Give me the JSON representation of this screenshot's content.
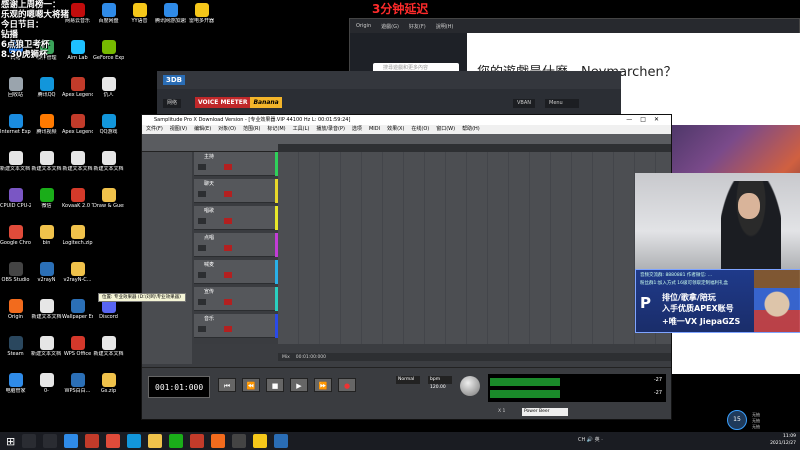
{
  "stream_overlay": {
    "lines": [
      "感谢上周榜一：",
      "乐观的嗯嗯大将猪",
      "今日节目：",
      "钻播",
      "6点狼卫考杯",
      "8.30虎狮杯"
    ],
    "delay_notice": "3分钟延迟"
  },
  "desktop_icons": [
    {
      "label": "网络",
      "color": "#2d7be0",
      "col": 0,
      "row": 1
    },
    {
      "label": "回收站",
      "color": "#9aa4ad",
      "col": 0,
      "row": 2
    },
    {
      "label": "Internet Explorer",
      "color": "#1a8ce0",
      "col": 0,
      "row": 3
    },
    {
      "label": "新建文本文档 (2)",
      "color": "#e6e6e6",
      "col": 0,
      "row": 4
    },
    {
      "label": "CPUID CPU-Z",
      "color": "#7a56c4",
      "col": 0,
      "row": 5
    },
    {
      "label": "Google Chrome",
      "color": "#e04b3a",
      "col": 0,
      "row": 6
    },
    {
      "label": "OBS Studio",
      "color": "#444444",
      "col": 0,
      "row": 7
    },
    {
      "label": "Origin",
      "color": "#f26b1d",
      "col": 0,
      "row": 8
    },
    {
      "label": "Steam",
      "color": "#2a475e",
      "col": 0,
      "row": 9
    },
    {
      "label": "电脑管家",
      "color": "#2f8be8",
      "col": 0,
      "row": 10
    },
    {
      "label": "软件管理",
      "color": "#3aa35a",
      "col": 1,
      "row": 1
    },
    {
      "label": "腾讯QQ",
      "color": "#1296db",
      "col": 1,
      "row": 2
    },
    {
      "label": "腾讯视频",
      "color": "#ff7a00",
      "col": 1,
      "row": 3
    },
    {
      "label": "新建文本文档",
      "color": "#e6e6e6",
      "col": 1,
      "row": 4
    },
    {
      "label": "微信",
      "color": "#1aad19",
      "col": 1,
      "row": 5
    },
    {
      "label": "bin",
      "color": "#f0c24b",
      "col": 1,
      "row": 6
    },
    {
      "label": "v2rayN",
      "color": "#2b6fb6",
      "col": 1,
      "row": 7
    },
    {
      "label": "新建文本文档",
      "color": "#e6e6e6",
      "col": 1,
      "row": 8
    },
    {
      "label": "新建文本文档 (2)",
      "color": "#e6e6e6",
      "col": 1,
      "row": 9
    },
    {
      "label": "0-",
      "color": "#e6e6e6",
      "col": 1,
      "row": 10
    },
    {
      "label": "网易云音乐",
      "color": "#c20c0c",
      "col": 2,
      "row": 0
    },
    {
      "label": "Aim Lab",
      "color": "#1ec0ff",
      "col": 2,
      "row": 1
    },
    {
      "label": "Apex Legends",
      "color": "#c23b2a",
      "col": 2,
      "row": 2
    },
    {
      "label": "Apex Legends",
      "color": "#c23b2a",
      "col": 2,
      "row": 3
    },
    {
      "label": "新建文本文档",
      "color": "#e6e6e6",
      "col": 2,
      "row": 4
    },
    {
      "label": "KovaaK 2.0 The Meta",
      "color": "#d43a2a",
      "col": 2,
      "row": 5
    },
    {
      "label": "Logitech.zip",
      "color": "#f0c24b",
      "col": 2,
      "row": 6
    },
    {
      "label": "v2rayN-C...",
      "color": "#f0c24b",
      "col": 2,
      "row": 7
    },
    {
      "label": "Wallpaper Engine: ...",
      "color": "#2b6fb6",
      "col": 2,
      "row": 8
    },
    {
      "label": "WPS Office",
      "color": "#d4382b",
      "col": 2,
      "row": 9
    },
    {
      "label": "WPS白白...",
      "color": "#2b6fb6",
      "col": 2,
      "row": 10
    },
    {
      "label": "百度网盘",
      "color": "#2f8be8",
      "col": 3,
      "row": 0
    },
    {
      "label": "GeForce Experience",
      "color": "#76b900",
      "col": 3,
      "row": 1
    },
    {
      "label": "仇人",
      "color": "#e6e6e6",
      "col": 3,
      "row": 2
    },
    {
      "label": "QQ游戏",
      "color": "#1296db",
      "col": 3,
      "row": 3
    },
    {
      "label": "新建文本文档",
      "color": "#e6e6e6",
      "col": 3,
      "row": 4
    },
    {
      "label": "Draw & Guess",
      "color": "#f0c24b",
      "col": 3,
      "row": 5
    },
    {
      "label": "Discord",
      "color": "#5865f2",
      "col": 3,
      "row": 8
    },
    {
      "label": "新建文本文档",
      "color": "#e6e6e6",
      "col": 3,
      "row": 9
    },
    {
      "label": "Gs.zip",
      "color": "#f0c24b",
      "col": 3,
      "row": 10
    },
    {
      "label": "YY语音",
      "color": "#f5c71a",
      "col": 4,
      "row": 0
    },
    {
      "label": "腾讯网游加速器",
      "color": "#2f8be8",
      "col": 5,
      "row": 0
    },
    {
      "label": "雷电多开器",
      "color": "#f5c71a",
      "col": 6,
      "row": 0
    }
  ],
  "origin": {
    "tabs": [
      "Origin",
      "遊戲(G)",
      "好友(F)",
      "說明(H)"
    ],
    "search_placeholder": "搜尋遊戲和更多內容",
    "headline": "您的遊戲是什麼，Neymarchen？"
  },
  "voicemeeter": {
    "title_a": "VOICE MEETER",
    "title_b": "Banana",
    "vban_label": "VBAN",
    "menu_label": "Menu",
    "left_label": "网络"
  },
  "samplitude": {
    "title": "Samplitude Pro X Download Version - [专业效果器.VIP   44100 Hz L: 00:01:59:24]",
    "menu": [
      "文件(F)",
      "视图(V)",
      "编辑(E)",
      "对象(O)",
      "范围(R)",
      "标记(M)",
      "工具(L)",
      "播放/录音(P)",
      "选项",
      "MIDI",
      "效果(X)",
      "在线(O)",
      "窗口(W)",
      "帮助(H)"
    ],
    "tracks": [
      {
        "name": "主持",
        "color": "#2fd05a"
      },
      {
        "name": "聊天",
        "color": "#e8d82a"
      },
      {
        "name": "唱歌",
        "color": "#e8e82a"
      },
      {
        "name": "点唱",
        "color": "#c23cd6"
      },
      {
        "name": "喊麦",
        "color": "#2ab0e8"
      },
      {
        "name": "宣传",
        "color": "#2ad0c0"
      },
      {
        "name": "音乐",
        "color": "#2a4ae8"
      }
    ],
    "status_items": [
      "Mix",
      "00:01:00:000"
    ],
    "time_display": "001:01:000",
    "transport_buttons": [
      "⏮",
      "⏪",
      "■",
      "▶",
      "⏩",
      "●"
    ],
    "mode_label": "Normal",
    "bpm_label": "bpm 120.00",
    "meter_values": [
      "-27",
      "-27"
    ],
    "zoom_label": "X 1",
    "preset_label": "Power Beer"
  },
  "tooltip": "位置: 专业效果器 (D:\\刘鸣\\专业效果器)",
  "banner": {
    "line1": "音频交流群: 8880881   作者微信: ...",
    "line2": "粉丝群1:加入方式   16级可领取定制福利礼盒",
    "big1": "排位/歌拿/陪玩",
    "big2": "入手优质APEX账号",
    "big3": "+唯一VX  JiepaGZS"
  },
  "timer": {
    "value": "15",
    "notes": [
      "无抽",
      "无抽",
      "无抽"
    ]
  },
  "taskbar": {
    "tray_text": "CH 🔊 英 ·",
    "time": "11:09",
    "date": "2021/12/27",
    "apps": [
      {
        "name": "search-app",
        "color": "#2a2c32"
      },
      {
        "name": "taskview-app",
        "color": "#2a2c32"
      },
      {
        "name": "edge-app",
        "color": "#2f8be8"
      },
      {
        "name": "samplitude-app",
        "color": "#c23b2a"
      },
      {
        "name": "chrome-app",
        "color": "#e04b3a"
      },
      {
        "name": "qq-app",
        "color": "#1296db"
      },
      {
        "name": "explorer-app",
        "color": "#f0c24b"
      },
      {
        "name": "wechat-app",
        "color": "#1aad19"
      },
      {
        "name": "apex-app",
        "color": "#c23b2a"
      },
      {
        "name": "origin-app",
        "color": "#f26b1d"
      },
      {
        "name": "obs-app",
        "color": "#444444"
      },
      {
        "name": "yy-app",
        "color": "#f5c71a"
      },
      {
        "name": "voicemeeter-app",
        "color": "#2a6db5"
      }
    ]
  }
}
